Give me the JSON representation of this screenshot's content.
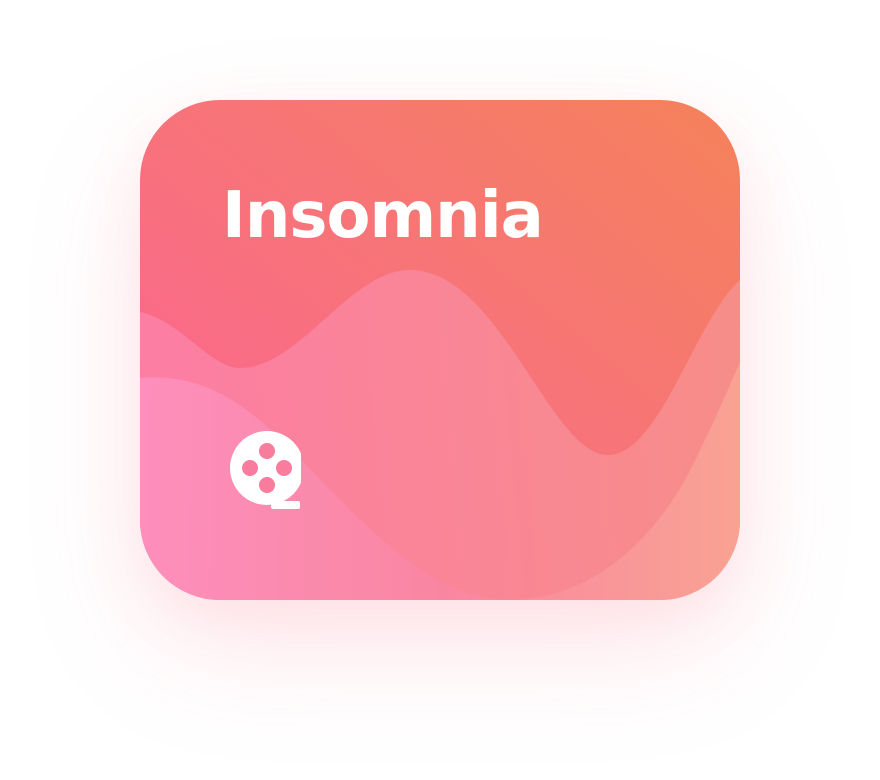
{
  "card": {
    "title": "Insomnia",
    "icon": "film-reel-icon",
    "colors": {
      "gradient_top_left": "#fb6f98",
      "gradient_top_right": "#f47f5e",
      "wave_bottom_left": "#fd8fbf",
      "wave_bottom_right": "#f9a391",
      "icon": "#ffffff"
    }
  }
}
